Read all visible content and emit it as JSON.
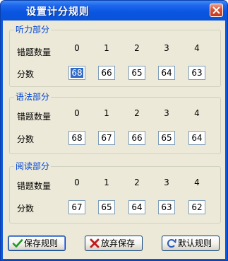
{
  "window": {
    "title": "设置计分规则"
  },
  "labels": {
    "wrong_count": "错题数量",
    "score": "分数"
  },
  "columns": [
    "0",
    "1",
    "2",
    "3",
    "4"
  ],
  "sections": [
    {
      "title": "听力部分",
      "scores": [
        "68",
        "66",
        "65",
        "64",
        "63"
      ],
      "selected_index": 0
    },
    {
      "title": "语法部分",
      "scores": [
        "68",
        "67",
        "66",
        "65",
        "64"
      ]
    },
    {
      "title": "阅读部分",
      "scores": [
        "67",
        "65",
        "64",
        "63",
        "62"
      ]
    }
  ],
  "buttons": {
    "save": "保存规则",
    "discard": "放弃保存",
    "default": "默认规则"
  },
  "icons": {
    "save": "checkmark-icon",
    "discard": "x-icon",
    "default": "refresh-icon",
    "close": "close-icon"
  },
  "colors": {
    "title_bar": "#0a55e0",
    "group_title": "#0046d5",
    "dialog_bg": "#ece9d8"
  }
}
